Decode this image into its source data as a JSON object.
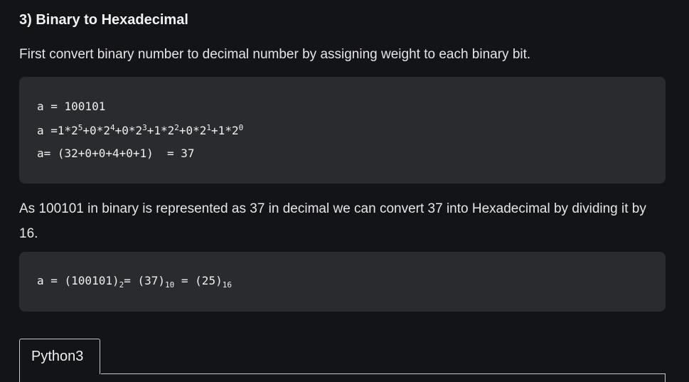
{
  "heading": "3) Binary to Hexadecimal",
  "intro": "First convert binary number to decimal number by assigning weight to each binary bit.",
  "code_block_1": {
    "line1": "a = 100101",
    "line2": {
      "prefix": "a =1*2",
      "e5": "5",
      "t1": "+0*2",
      "e4": "4",
      "t2": "+0*2",
      "e3": "3",
      "t3": "+1*2",
      "e2": "2",
      "t4": "+0*2",
      "e1": "1",
      "t5": "+1*2",
      "e0": "0"
    },
    "line3": "a= (32+0+0+4+0+1)  = 37"
  },
  "explanation": "As 100101 in binary is represented as 37 in decimal we can convert 37 into Hexadecimal by dividing it by 16.",
  "code_block_2": {
    "prefix": "a = ",
    "bin": "(100101)",
    "bin_base": "2",
    "eq1": "= ",
    "dec": "(37)",
    "dec_base": "10",
    "eq2": " = ",
    "hex": "(25)",
    "hex_base": "16"
  },
  "tabs": [
    {
      "label": "Python3"
    }
  ]
}
